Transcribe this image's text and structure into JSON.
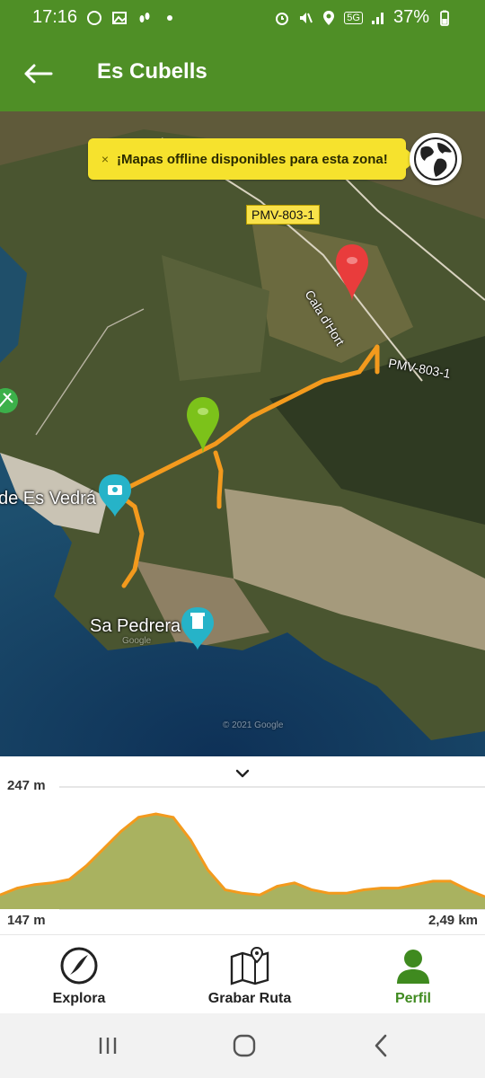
{
  "status_bar": {
    "time": "17:16",
    "battery": "37%",
    "network": "5G",
    "left_icons": [
      "whatsapp-icon",
      "gallery-icon",
      "footsteps-icon",
      "dot-icon"
    ],
    "right_icons": [
      "alarm-icon",
      "mute-icon",
      "location-icon",
      "5g-icon",
      "signal-icon",
      "battery-icon"
    ]
  },
  "app_bar": {
    "title": "Es Cubells",
    "back_icon": "arrow-left-icon"
  },
  "map": {
    "offline_banner": {
      "close": "×",
      "text": "¡Mapas offline disponibles para esta zona!"
    },
    "globe_icon": "globe-icon",
    "road_label": "PMV-803-1",
    "labels": {
      "road_right": "PMV-803-1",
      "road_cala": "Cala d'Hort",
      "place_vedra": "de Es Vedrá",
      "place_pedrera": "Sa Pedrera",
      "watermark_1": "Google",
      "watermark_2": "© 2021 Google"
    },
    "colors": {
      "track": "#f39a1d",
      "start_marker": "#7cc21a",
      "end_marker": "#e93c3c",
      "poi": "#26b3c8"
    }
  },
  "elevation": {
    "max_label": "247 m",
    "min_label": "147 m",
    "distance_label": "2,49 km",
    "chevron_icon": "chevron-down-icon",
    "profile": [
      0.06,
      0.14,
      0.18,
      0.2,
      0.24,
      0.4,
      0.6,
      0.8,
      0.96,
      1.0,
      0.96,
      0.7,
      0.35,
      0.12,
      0.08,
      0.06,
      0.16,
      0.2,
      0.12,
      0.08,
      0.08,
      0.12,
      0.14,
      0.14,
      0.18,
      0.22,
      0.22,
      0.12,
      0.04
    ],
    "fill_color": "#a9b260",
    "line_color": "#f39a1d"
  },
  "tab_bar": {
    "items": [
      {
        "label": "Explora",
        "icon": "wikiloc-icon",
        "active": false
      },
      {
        "label": "Grabar Ruta",
        "icon": "map-pin-icon",
        "active": false
      },
      {
        "label": "Perfil",
        "icon": "user-icon",
        "active": true
      }
    ],
    "active_color": "#3f8a1f"
  },
  "nav_bar": {
    "recent_icon": "recent-apps-icon",
    "home_icon": "home-icon",
    "back_icon": "back-icon"
  }
}
